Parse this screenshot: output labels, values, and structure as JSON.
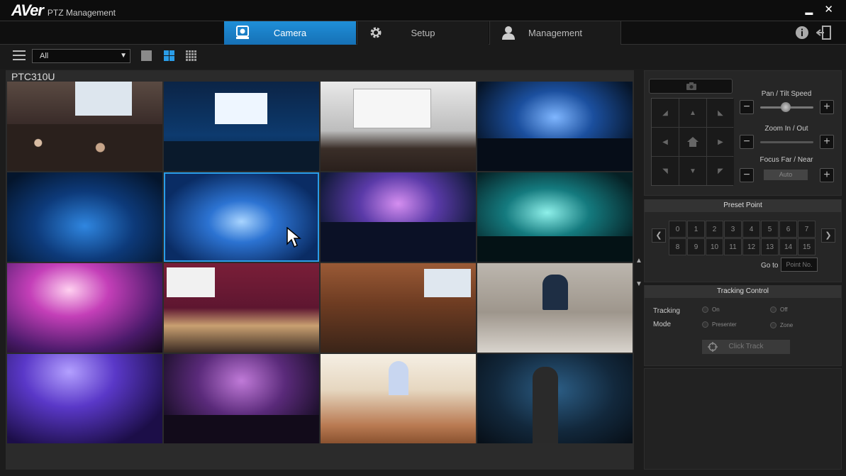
{
  "app": {
    "brand": "AVer",
    "title": "PTZ Management"
  },
  "window": {
    "minimize": "▬",
    "close": "✕"
  },
  "tabs": [
    {
      "label": "Camera",
      "active": true
    },
    {
      "label": "Setup",
      "active": false
    },
    {
      "label": "Management",
      "active": false
    }
  ],
  "toolbar": {
    "group_select": "All"
  },
  "camera_name": "PTC310U",
  "ptz": {
    "pan_tilt_label": "Pan / Tilt Speed",
    "zoom_label": "Zoom In / Out",
    "focus_label": "Focus Far / Near",
    "auto_label": "Auto",
    "minus": "−",
    "plus": "+"
  },
  "preset": {
    "header": "Preset Point",
    "points": [
      "0",
      "1",
      "2",
      "3",
      "4",
      "5",
      "6",
      "7",
      "8",
      "9",
      "10",
      "11",
      "12",
      "13",
      "14",
      "15"
    ],
    "goto_label": "Go to",
    "point_placeholder": "Point No."
  },
  "tracking": {
    "header": "Tracking Control",
    "tracking_label": "Tracking",
    "mode_label": "Mode",
    "on": "On",
    "off": "Off",
    "presenter": "Presenter",
    "zone": "Zone",
    "click_track": "Click Track"
  },
  "colors": {
    "accent": "#2a9de8",
    "bg": "#1c1c1c"
  }
}
